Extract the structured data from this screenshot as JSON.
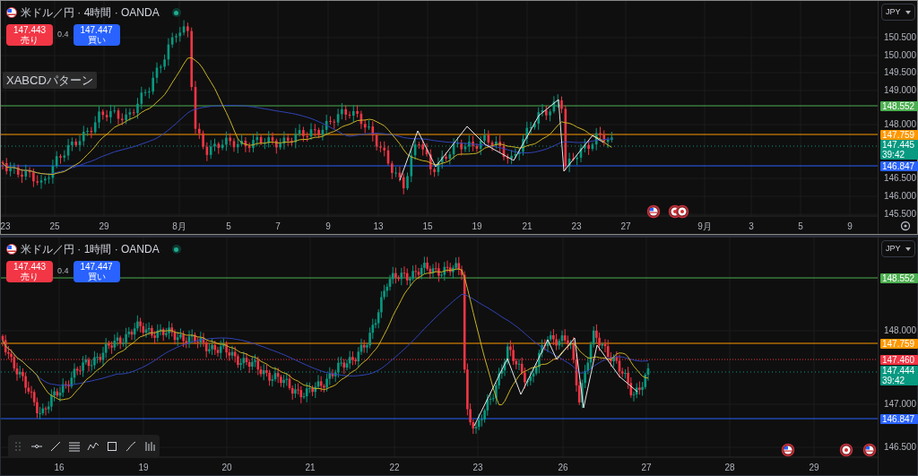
{
  "panels": [
    {
      "title": "米ドル／円 · 4時間 · OANDA",
      "selected": true,
      "market_open": true,
      "sell": {
        "price": "147.443",
        "label": "売り"
      },
      "spread": "0.4",
      "buy": {
        "price": "147.447",
        "label": "買い"
      },
      "pattern_label": "XABCDパターン",
      "currency": "JPY",
      "y_ticks": [
        "150.500",
        "150.000",
        "149.500",
        "149.000",
        "148.000",
        "146.500",
        "146.000",
        "145.500"
      ],
      "price_tags": [
        {
          "text": "148.552",
          "color": "#4caf50"
        },
        {
          "text": "147.759",
          "color": "#ff9800"
        },
        {
          "text": "146.847",
          "color": "#2962ff"
        }
      ],
      "current": {
        "price": "147.445",
        "countdown": "39:42"
      },
      "x_labels": [
        "23",
        "25",
        "29",
        "8月",
        "5",
        "7",
        "9",
        "13",
        "15",
        "19",
        "21",
        "23",
        "27",
        "9月",
        "3",
        "5",
        "9"
      ]
    },
    {
      "title": "米ドル／円 · 1時間 · OANDA",
      "selected": false,
      "market_open": true,
      "sell": {
        "price": "147.443",
        "label": "売り"
      },
      "spread": "0.4",
      "buy": {
        "price": "147.447",
        "label": "買い"
      },
      "currency": "JPY",
      "y_ticks": [
        "148.000",
        "147.000",
        "146.500"
      ],
      "price_tags": [
        {
          "text": "148.552",
          "color": "#4caf50"
        },
        {
          "text": "147.759",
          "color": "#ff9800"
        },
        {
          "text": "147.460",
          "color": "#f23645"
        },
        {
          "text": "146.847",
          "color": "#2962ff"
        }
      ],
      "current": {
        "price": "147.444",
        "countdown": "39:42"
      },
      "x_labels": [
        "16",
        "19",
        "20",
        "21",
        "22",
        "23",
        "26",
        "27",
        "28",
        "29"
      ]
    }
  ]
}
